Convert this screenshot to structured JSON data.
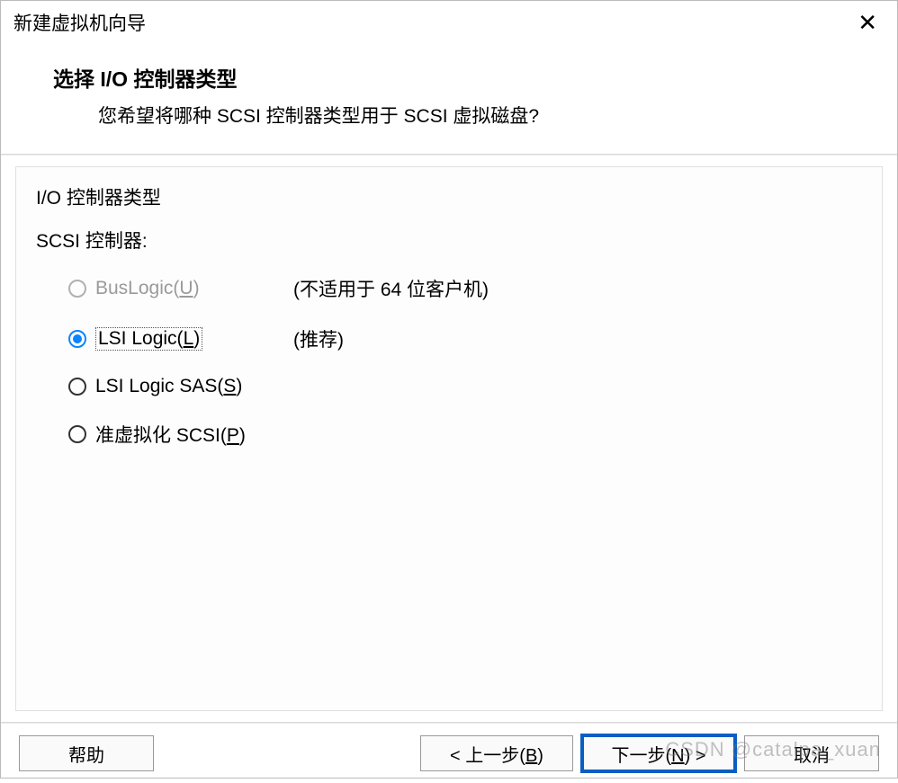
{
  "window": {
    "title": "新建虚拟机向导"
  },
  "header": {
    "title": "选择 I/O 控制器类型",
    "subtitle": "您希望将哪种 SCSI 控制器类型用于 SCSI 虚拟磁盘?"
  },
  "group": {
    "label": "I/O 控制器类型",
    "sublabel": "SCSI 控制器:"
  },
  "options": {
    "buslogic": {
      "label_prefix": "BusLogic(",
      "hotkey": "U",
      "label_suffix": ")",
      "note": "(不适用于 64 位客户机)"
    },
    "lsilogic": {
      "label_prefix": "LSI Logic(",
      "hotkey": "L",
      "label_suffix": ")",
      "note": "(推荐)"
    },
    "lsisas": {
      "label_prefix": "LSI Logic SAS(",
      "hotkey": "S",
      "label_suffix": ")"
    },
    "pvscsi": {
      "label_prefix": "准虚拟化 SCSI(",
      "hotkey": "P",
      "label_suffix": ")"
    }
  },
  "buttons": {
    "help": "帮助",
    "back_prefix": "< 上一步(",
    "back_hotkey": "B",
    "back_suffix": ")",
    "next_prefix": "下一步(",
    "next_hotkey": "N",
    "next_suffix": ") >",
    "cancel": "取消"
  },
  "watermark": "CSDN @catalpa_xuan"
}
